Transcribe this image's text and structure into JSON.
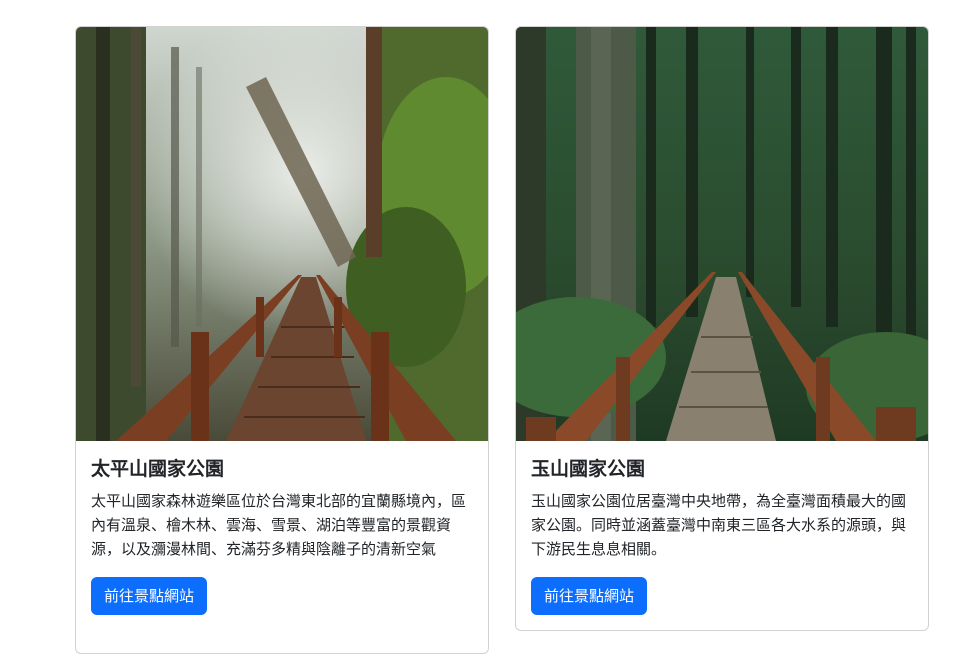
{
  "colors": {
    "primary_button": "#0d6efd",
    "card_border": "#d9d9d9",
    "text": "#212529"
  },
  "cards": [
    {
      "image_icon": "forest-boardwalk-photo",
      "title": "太平山國家公園",
      "text": "太平山國家森林遊樂區位於台灣東北部的宜蘭縣境內，區內有溫泉、檜木林、雲海、雪景、湖泊等豐富的景觀資源，以及瀰漫林間、充滿芬多精與陰離子的清新空氣",
      "button_label": "前往景點網站"
    },
    {
      "image_icon": "forest-boardwalk-photo",
      "title": "玉山國家公園",
      "text": "玉山國家公園位居臺灣中央地帶，為全臺灣面積最大的國家公園。同時並涵蓋臺灣中南東三區各大水系的源頭，與下游民生息息相關。",
      "button_label": "前往景點網站"
    }
  ]
}
